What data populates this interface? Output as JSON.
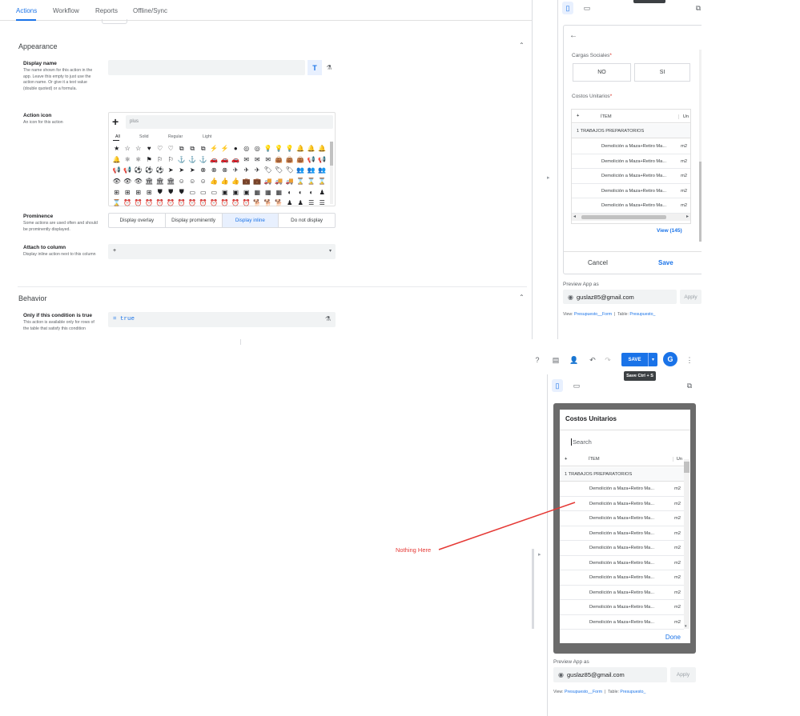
{
  "tabs": [
    {
      "label": "Actions",
      "active": true
    },
    {
      "label": "Workflow",
      "active": false
    },
    {
      "label": "Reports",
      "active": false
    },
    {
      "label": "Offline/Sync",
      "active": false
    }
  ],
  "appearance": {
    "title": "Appearance",
    "display_name": {
      "label": "Display name",
      "hint": "The name shown for this action in the app. Leave this empty to just use the action name. Or give it a text value (double quoted) or a formula.",
      "value": ""
    },
    "action_icon": {
      "label": "Action icon",
      "hint": "An icon for this action",
      "search_value": "plus",
      "filters": [
        "All",
        "Solid",
        "Regular",
        "Light"
      ]
    },
    "prominence": {
      "label": "Prominence",
      "hint": "Some actions are used often and should be prominently displayed.",
      "options": [
        "Display overlay",
        "Display prominently",
        "Display inline",
        "Do not display"
      ],
      "selected": "Display inline"
    },
    "attach_column": {
      "label": "Attach to column",
      "hint": "Display inline action next to this column",
      "value": "+"
    }
  },
  "behavior": {
    "title": "Behavior",
    "condition": {
      "label": "Only if this condition is true",
      "hint": "This action is available only for rows of the table that satisfy this condition",
      "value": "= true"
    }
  },
  "icon_glyphs": [
    "★",
    "☆",
    "☆",
    "♥",
    "♡",
    "♡",
    "⧉",
    "⧉",
    "⧉",
    "⚡",
    "⚡",
    "●",
    "◎",
    "◎",
    "💡",
    "💡",
    "💡",
    "🔔",
    "🔔",
    "🔔",
    "🔔",
    "⚛",
    "⚛",
    "⚑",
    "⚐",
    "⚐",
    "⚓",
    "⚓",
    "⚓",
    "🚗",
    "🚗",
    "🚗",
    "✉",
    "✉",
    "✉",
    "👜",
    "👜",
    "👜",
    "📢",
    "📢",
    "📢",
    "📢",
    "⚽",
    "⚽",
    "⚽",
    "➤",
    "➤",
    "➤",
    "⊗",
    "⊗",
    "⊗",
    "✈",
    "✈",
    "✈",
    "🏷",
    "🏷",
    "🏷",
    "👥",
    "👥",
    "👥",
    "👁",
    "👁",
    "👁",
    "🏛",
    "🏛",
    "🏛",
    "☺",
    "☺",
    "☺",
    "👍",
    "👍",
    "👍",
    "💼",
    "💼",
    "🚚",
    "🚚",
    "🚚",
    "⌛",
    "⌛",
    "⌛",
    "⊞",
    "⊞",
    "⊞",
    "⊞",
    "⛊",
    "⛊",
    "⛊",
    "▭",
    "▭",
    "▭",
    "▣",
    "▣",
    "▣",
    "▦",
    "▦",
    "▦",
    "◐",
    "◐",
    "◐",
    "♟",
    "⌛",
    "⏰",
    "⏰",
    "⏰",
    "⏰",
    "⏰",
    "⏰",
    "⏰",
    "⏰",
    "⏰",
    "⏰",
    "⏰",
    "⏰",
    "🐕",
    "🐕",
    "🐕",
    "♟",
    "♟",
    "☰",
    "☰"
  ],
  "preview_top": {
    "form": {
      "cargas_label": "Cargas Sociales",
      "required_mark": "*",
      "no_label": "NO",
      "si_label": "SI",
      "costos_label": "Costos Unitarios",
      "table_headers": {
        "plus": "+",
        "item": "ÍTEM",
        "un": "Un"
      },
      "group_row": "1 TRABAJOS PREPARATORIOS",
      "rows": [
        {
          "item": "Demolición a Maza+Retiro Ma...",
          "un": "m2"
        },
        {
          "item": "Demolición a Maza+Retiro Ma...",
          "un": "m2"
        },
        {
          "item": "Demolición a Maza+Retiro Ma...",
          "un": "m2"
        },
        {
          "item": "Demolición a Maza+Retiro Ma...",
          "un": "m2"
        },
        {
          "item": "Demolición a Maza+Retiro Ma...",
          "un": "m2"
        }
      ],
      "view_link": "View (145)",
      "cancel_label": "Cancel",
      "save_label": "Save"
    },
    "preview_as_label": "Preview App as",
    "email": "guslaz85@gmail.com",
    "apply_label": "Apply",
    "view_label": "View:",
    "view_value": "Presupuesto__Form",
    "table_label": "Table:",
    "table_value": "Presupuesto_"
  },
  "preview_bottom": {
    "toolbar": {
      "save_label": "SAVE",
      "tooltip": "Save Ctrl + S",
      "avatar_letter": "G"
    },
    "dialog": {
      "title": "Costos Unitarios",
      "search_placeholder": "Search",
      "table_headers": {
        "plus": "+",
        "item": "ÍTEM",
        "un": "Un"
      },
      "group_row": "1 TRABAJOS PREPARATORIOS",
      "rows": [
        {
          "item": "Demolición a Maza+Retiro Ma...",
          "un": "m2"
        },
        {
          "item": "Demolición a Maza+Retiro Ma...",
          "un": "m2"
        },
        {
          "item": "Demolición a Maza+Retiro Ma...",
          "un": "m2"
        },
        {
          "item": "Demolición a Maza+Retiro Ma...",
          "un": "m2"
        },
        {
          "item": "Demolición a Maza+Retiro Ma...",
          "un": "m2"
        },
        {
          "item": "Demolición a Maza+Retiro Ma...",
          "un": "m2"
        },
        {
          "item": "Demolición a Maza+Retiro Ma...",
          "un": "m2"
        },
        {
          "item": "Demolición a Maza+Retiro Ma...",
          "un": "m2"
        },
        {
          "item": "Demolición a Maza+Retiro Ma...",
          "un": "m2"
        },
        {
          "item": "Demolición a Maza+Retiro Ma...",
          "un": "m2"
        }
      ],
      "done_label": "Done"
    },
    "preview_as_label": "Preview App as",
    "email": "guslaz85@gmail.com",
    "apply_label": "Apply",
    "view_label": "View:",
    "view_value": "Presupuesto__Form",
    "table_label": "Table:",
    "table_value": "Presupuesto_"
  },
  "annotation": {
    "text": "Nothing Here",
    "color": "#e53935"
  },
  "colors": {
    "accent": "#1a73e8",
    "annotation": "#e53935"
  }
}
